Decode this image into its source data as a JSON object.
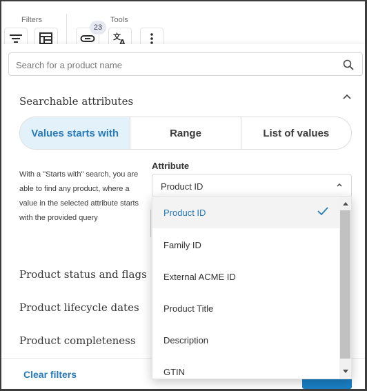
{
  "toolbar": {
    "filters_label": "Filters",
    "tools_label": "Tools",
    "badge_count": "23",
    "icons": [
      "filter-lines-icon",
      "table-edit-icon",
      "link-icon",
      "translate-icon",
      "more-vertical-icon"
    ]
  },
  "search": {
    "placeholder": "Search for a product name"
  },
  "searchable": {
    "title": "Searchable attributes",
    "segments": [
      "Values starts with",
      "Range",
      "List of values"
    ],
    "selected_segment": "Values starts with",
    "help_text": "With a \"Starts with\" search, you are able to find any product, where a value in the selected attribute starts with the provided query",
    "attribute_label": "Attribute",
    "attribute_value": "Product ID"
  },
  "sections": [
    "Product status and flags",
    "Product lifecycle dates",
    "Product completeness"
  ],
  "dropdown": {
    "options": [
      "Product ID",
      "Family ID",
      "External ACME ID",
      "Product Title",
      "Description",
      "GTIN"
    ],
    "selected": "Product ID"
  },
  "footer": {
    "clear_label": "Clear filters"
  },
  "colors": {
    "accent": "#2a7ab6",
    "selected_segment_bg": "#e3f1fa",
    "apply_button": "#1a7fc4"
  }
}
